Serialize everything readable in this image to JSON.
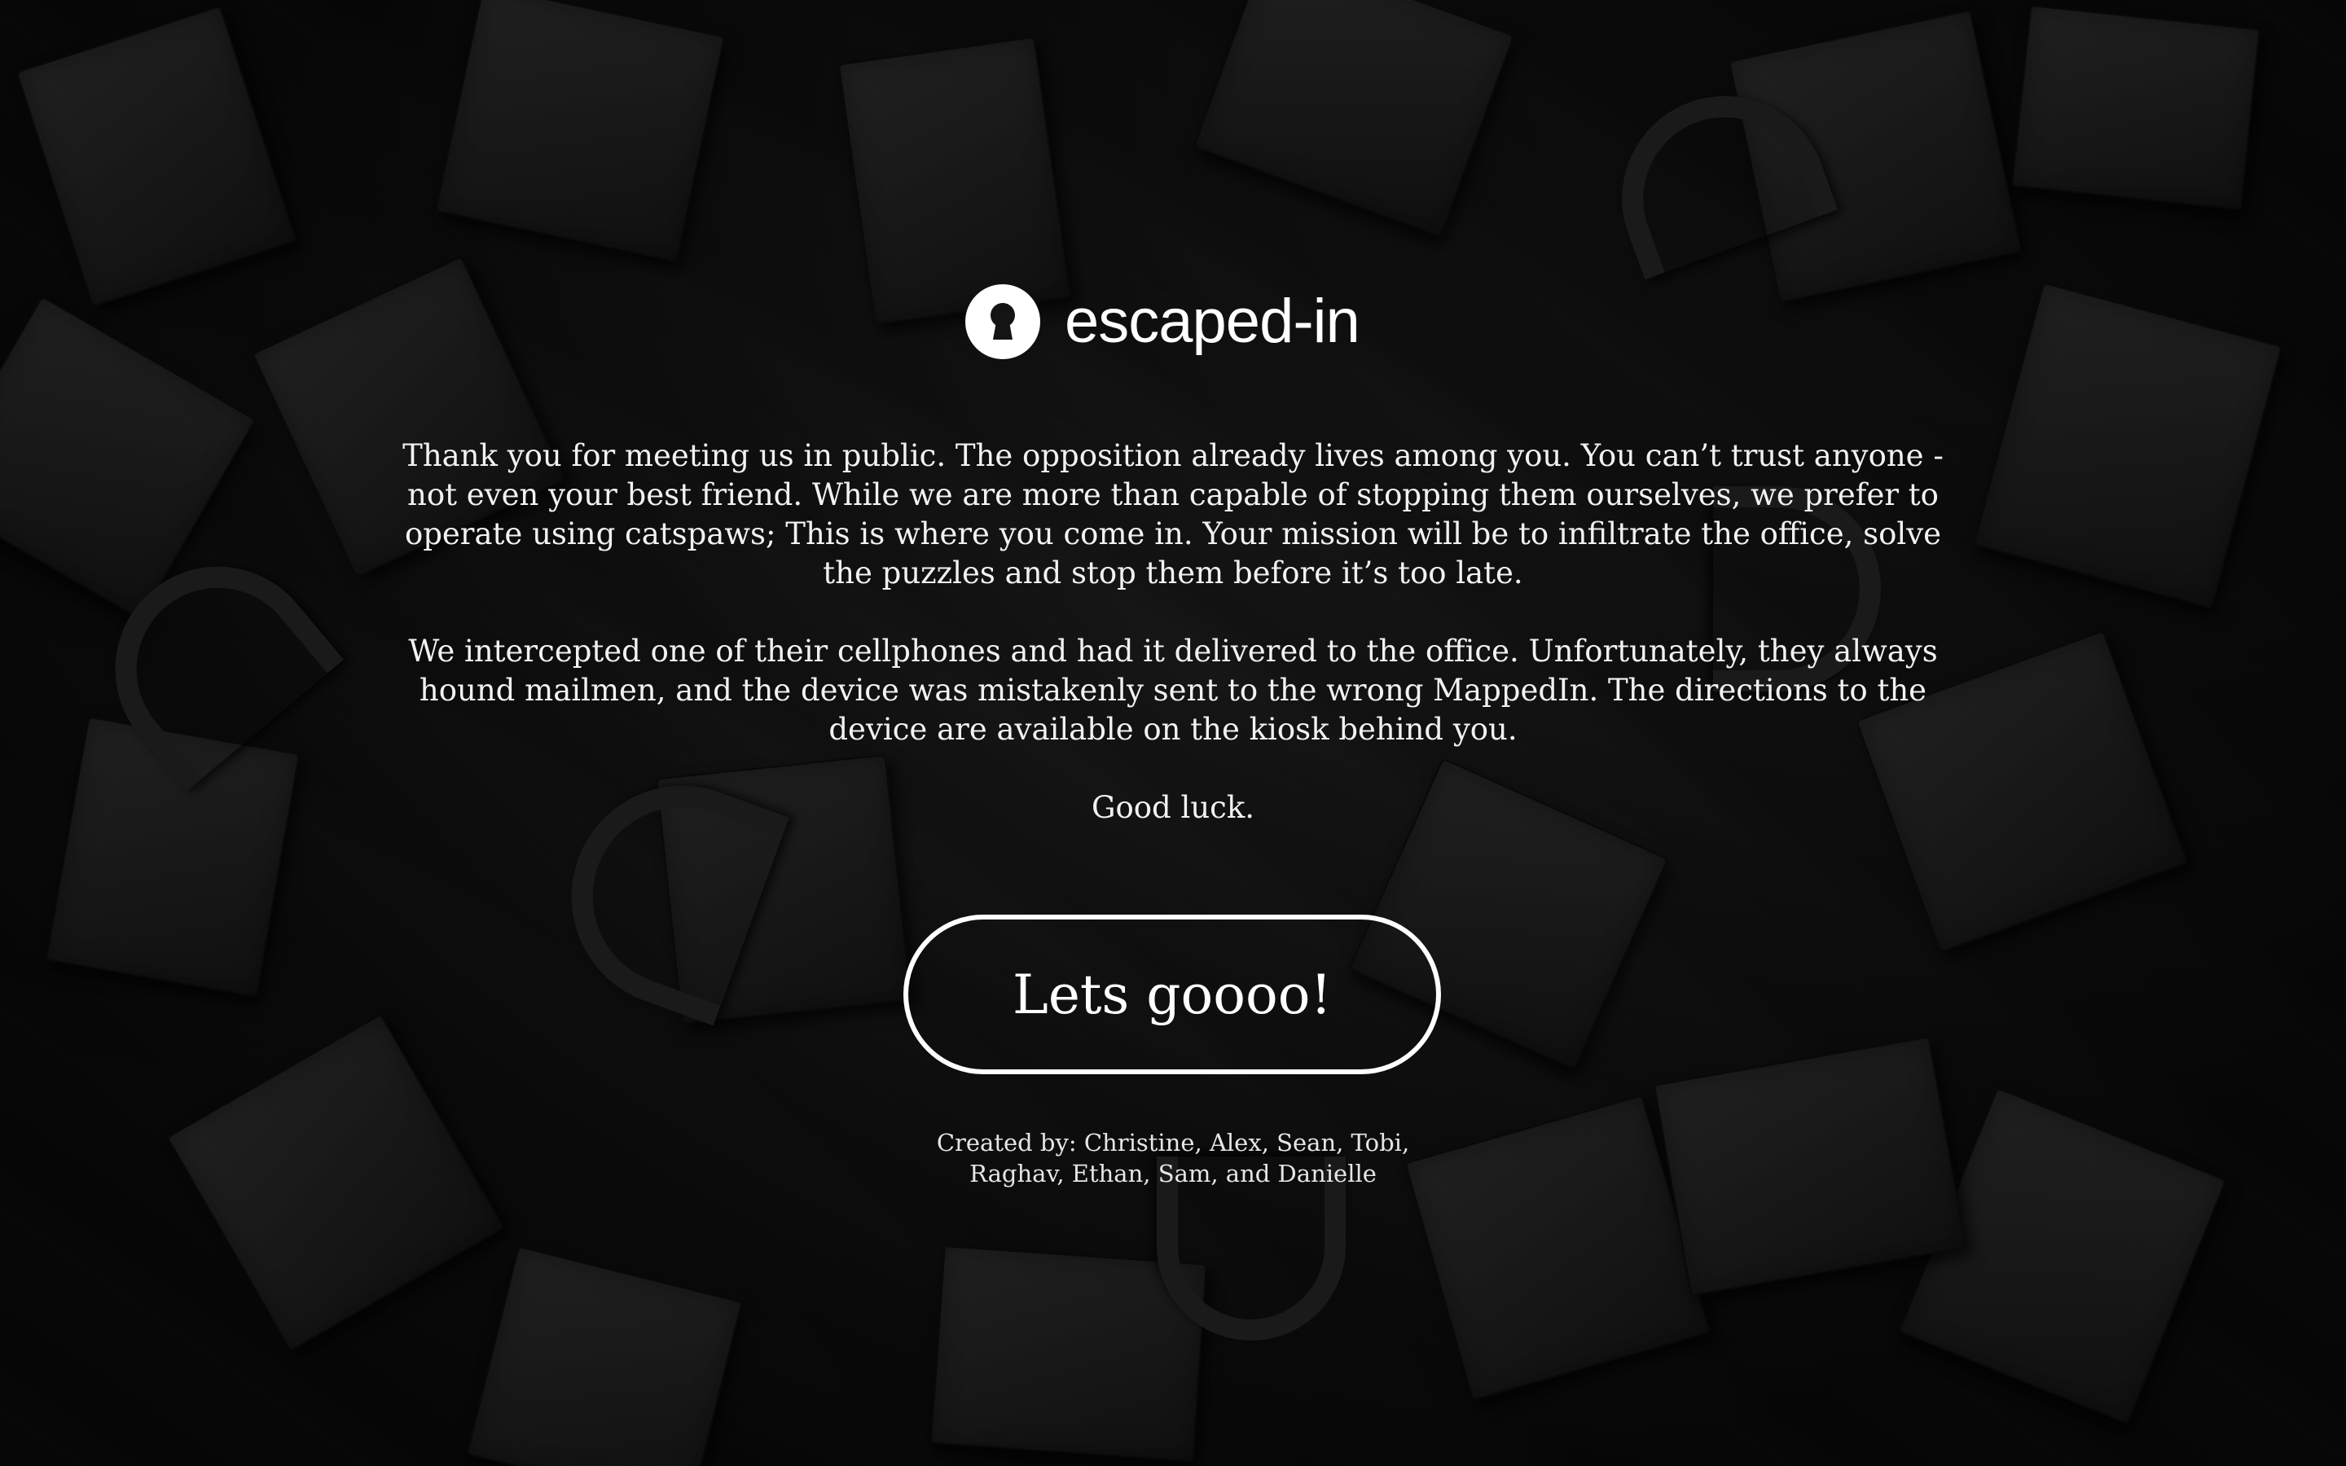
{
  "brand": {
    "name": "escaped-in",
    "logo_icon": "keyhole-icon"
  },
  "story": {
    "paragraphs": [
      "Thank you for meeting us in public. The opposition already lives among you. You can’t trust anyone - not even your best friend. While we are more than capable of stopping them ourselves, we prefer to operate using catspaws; This is where you come in. Your mission will be to infiltrate the office, solve the puzzles and stop them before it’s too late.",
      "We intercepted one of their cellphones and had it delivered to the office. Unfortunately, they always hound mailmen, and the device was mistakenly sent to the wrong MappedIn. The directions to the device are available on the kiosk behind you.",
      "Good luck."
    ]
  },
  "cta": {
    "label": "Lets goooo!"
  },
  "credits": {
    "line1": "Created by: Christine, Alex, Sean, Tobi,",
    "line2": "Raghav, Ethan, Sam, and Danielle"
  },
  "colors": {
    "text": "#ffffff",
    "background": "#141414",
    "button_border": "#ffffff"
  }
}
